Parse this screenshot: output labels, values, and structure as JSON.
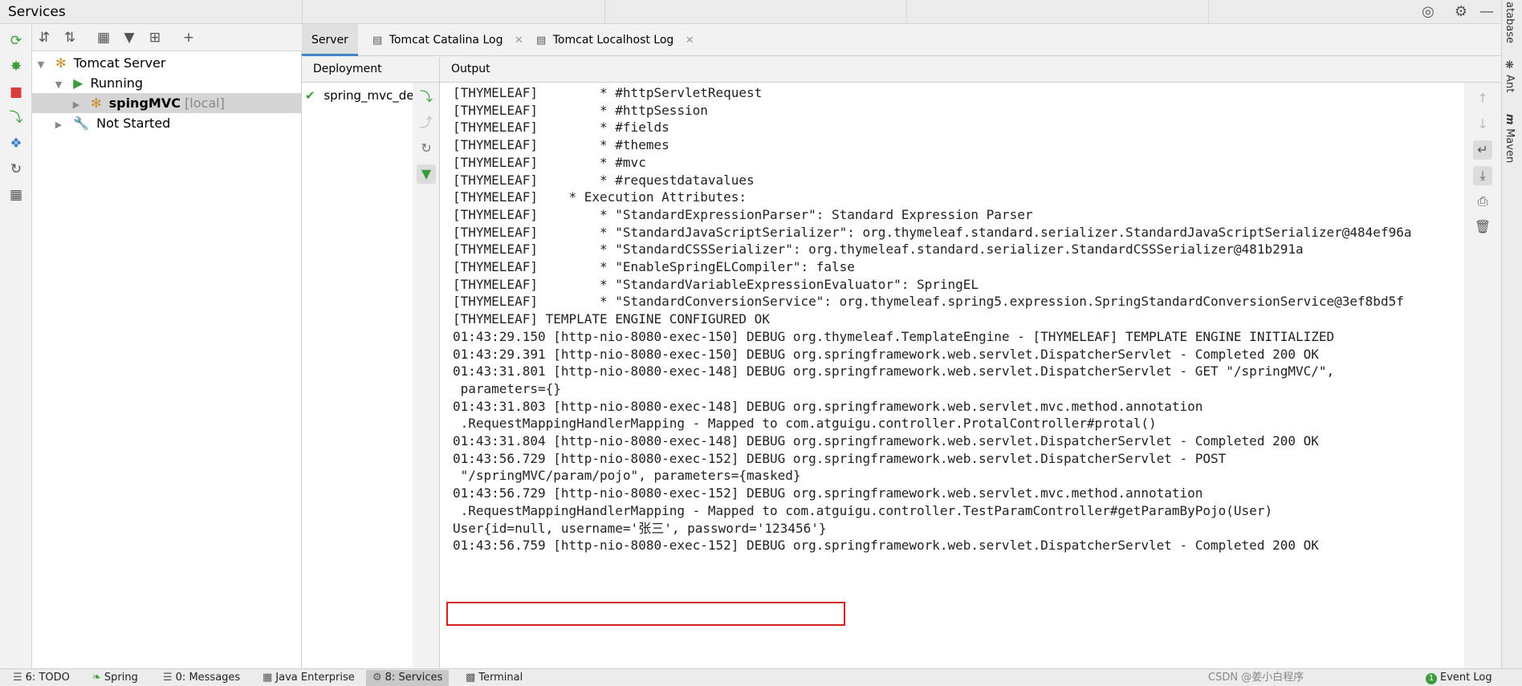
{
  "window": {
    "title": "Services"
  },
  "header_buttons": [
    "target-icon",
    "gear-icon",
    "minimize-icon"
  ],
  "tabs": [
    {
      "label": "Server",
      "closable": false,
      "active": true
    },
    {
      "label": "Tomcat Catalina Log",
      "closable": true,
      "active": false
    },
    {
      "label": "Tomcat Localhost Log",
      "closable": true,
      "active": false
    }
  ],
  "tree": {
    "root": "Tomcat Server",
    "group_running": "Running",
    "item_name": "spingMVC",
    "item_tag": "[local]",
    "group_not_started": "Not Started"
  },
  "panels": {
    "deployment_header": "Deployment",
    "output_header": "Output"
  },
  "deployment": {
    "item": "spring_mvc_de"
  },
  "output_lines": [
    "[THYMELEAF]        * #httpServletRequest",
    "[THYMELEAF]        * #httpSession",
    "[THYMELEAF]        * #fields",
    "[THYMELEAF]        * #themes",
    "[THYMELEAF]        * #mvc",
    "[THYMELEAF]        * #requestdatavalues",
    "[THYMELEAF]    * Execution Attributes:",
    "[THYMELEAF]        * \"StandardExpressionParser\": Standard Expression Parser",
    "[THYMELEAF]        * \"StandardJavaScriptSerializer\": org.thymeleaf.standard.serializer.StandardJavaScriptSerializer@484ef96a",
    "[THYMELEAF]        * \"StandardCSSSerializer\": org.thymeleaf.standard.serializer.StandardCSSSerializer@481b291a",
    "[THYMELEAF]        * \"EnableSpringELCompiler\": false",
    "[THYMELEAF]        * \"StandardVariableExpressionEvaluator\": SpringEL",
    "[THYMELEAF]        * \"StandardConversionService\": org.thymeleaf.spring5.expression.SpringStandardConversionService@3ef8bd5f",
    "[THYMELEAF] TEMPLATE ENGINE CONFIGURED OK",
    "01:43:29.150 [http-nio-8080-exec-150] DEBUG org.thymeleaf.TemplateEngine - [THYMELEAF] TEMPLATE ENGINE INITIALIZED",
    "01:43:29.391 [http-nio-8080-exec-150] DEBUG org.springframework.web.servlet.DispatcherServlet - Completed 200 OK",
    "01:43:31.801 [http-nio-8080-exec-148] DEBUG org.springframework.web.servlet.DispatcherServlet - GET \"/springMVC/\",",
    " parameters={}",
    "01:43:31.803 [http-nio-8080-exec-148] DEBUG org.springframework.web.servlet.mvc.method.annotation",
    " .RequestMappingHandlerMapping - Mapped to com.atguigu.controller.ProtalController#protal()",
    "01:43:31.804 [http-nio-8080-exec-148] DEBUG org.springframework.web.servlet.DispatcherServlet - Completed 200 OK",
    "01:43:56.729 [http-nio-8080-exec-152] DEBUG org.springframework.web.servlet.DispatcherServlet - POST",
    " \"/springMVC/param/pojo\", parameters={masked}",
    "01:43:56.729 [http-nio-8080-exec-152] DEBUG org.springframework.web.servlet.mvc.method.annotation",
    " .RequestMappingHandlerMapping - Mapped to com.atguigu.controller.TestParamController#getParamByPojo(User)",
    "User{id=null, username='张三', password='123456'}",
    "01:43:56.759 [http-nio-8080-exec-152] DEBUG org.springframework.web.servlet.DispatcherServlet - Completed 200 OK"
  ],
  "highlight_color": "#d61f1f",
  "right_sidebar": [
    "atabase",
    "Ant",
    "Maven"
  ],
  "statusbar": {
    "items": [
      "6: TODO",
      "Spring",
      "0: Messages",
      "Java Enterprise",
      "8: Services",
      "Terminal"
    ],
    "active": "8: Services",
    "event_log": "Event Log",
    "event_count": "1",
    "watermark": "CSDN @姜小白程序"
  }
}
